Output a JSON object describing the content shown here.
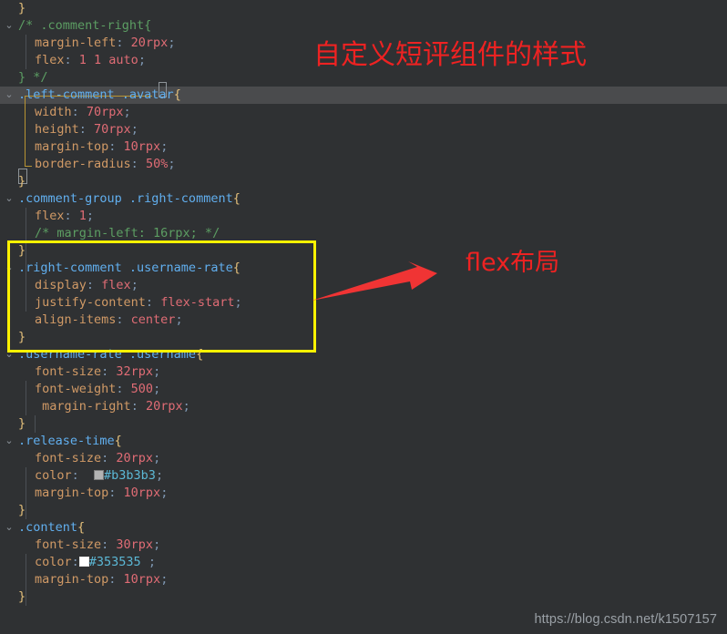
{
  "editor": {
    "background": "#2f3133",
    "active_line_background": "#4a4b4d",
    "active_line_index": 5,
    "line_height": 19,
    "first_line_top": 0,
    "colors": {
      "selector": "#61afef",
      "brace": "#e5c07b",
      "property": "#d19a66",
      "value": "#e06c75",
      "punctuation": "#7f98b3",
      "comment": "#5c9e63",
      "hex_literal": "#5cb8d6",
      "fold_chevron": "#8b9299",
      "indent_guide": "#4b5055",
      "scope_guide": "#b89433"
    },
    "lines": [
      {
        "indent": 0,
        "fold": false,
        "text": "}"
      },
      {
        "indent": 0,
        "fold": true,
        "text": "/* .comment-right{"
      },
      {
        "indent": 1,
        "fold": false,
        "text": "margin-left: 20rpx;"
      },
      {
        "indent": 1,
        "fold": false,
        "text": "flex: 1 1 auto;"
      },
      {
        "indent": 0,
        "fold": false,
        "text": "} */"
      },
      {
        "indent": 0,
        "fold": true,
        "text": ".left-comment .avatar{"
      },
      {
        "indent": 1,
        "fold": false,
        "text": "width: 70rpx;"
      },
      {
        "indent": 1,
        "fold": false,
        "text": "height: 70rpx;"
      },
      {
        "indent": 1,
        "fold": false,
        "text": "margin-top: 10rpx;"
      },
      {
        "indent": 1,
        "fold": false,
        "text": "border-radius: 50%;"
      },
      {
        "indent": 0,
        "fold": false,
        "text": "}"
      },
      {
        "indent": 0,
        "fold": true,
        "text": ".comment-group .right-comment{"
      },
      {
        "indent": 1,
        "fold": false,
        "text": "flex: 1;"
      },
      {
        "indent": 1,
        "fold": false,
        "text": "/* margin-left: 16rpx; */"
      },
      {
        "indent": 0,
        "fold": false,
        "text": "}"
      },
      {
        "indent": 0,
        "fold": true,
        "text": ".right-comment .username-rate{"
      },
      {
        "indent": 1,
        "fold": false,
        "text": "display: flex;"
      },
      {
        "indent": 1,
        "fold": false,
        "text": "justify-content: flex-start;"
      },
      {
        "indent": 1,
        "fold": false,
        "text": "align-items: center;"
      },
      {
        "indent": 0,
        "fold": false,
        "text": "}"
      },
      {
        "indent": 0,
        "fold": true,
        "text": ".username-rate .username{"
      },
      {
        "indent": 1,
        "fold": false,
        "text": "font-size: 32rpx;"
      },
      {
        "indent": 1,
        "fold": false,
        "text": "font-weight: 500;"
      },
      {
        "indent": 1,
        "fold": false,
        "text": " margin-right: 20rpx;"
      },
      {
        "indent": 0,
        "fold": false,
        "text": "}"
      },
      {
        "indent": 0,
        "fold": true,
        "text": ".release-time{"
      },
      {
        "indent": 1,
        "fold": false,
        "text": "font-size: 20rpx;"
      },
      {
        "indent": 1,
        "fold": false,
        "text": "color:  #b3b3b3;"
      },
      {
        "indent": 1,
        "fold": false,
        "text": "margin-top: 10rpx;"
      },
      {
        "indent": 0,
        "fold": false,
        "text": "}"
      },
      {
        "indent": 0,
        "fold": true,
        "text": ".content{"
      },
      {
        "indent": 1,
        "fold": false,
        "text": "font-size: 30rpx;"
      },
      {
        "indent": 1,
        "fold": false,
        "text": "color:#353535 ;"
      },
      {
        "indent": 1,
        "fold": false,
        "text": "margin-top: 10rpx;"
      },
      {
        "indent": 0,
        "fold": false,
        "text": "}"
      }
    ],
    "fold_chevron_glyph": "⌄",
    "swatches": [
      {
        "line": 27,
        "hex": "#b3b3b3"
      },
      {
        "line": 32,
        "hex": "#353535"
      }
    ]
  },
  "annotations": {
    "title_note": "自定义短评组件的样式",
    "flex_note": "flex布局",
    "annotation_color": "#ee2222",
    "highlight_box_color": "#fff200",
    "arrow_color": "#f03434"
  },
  "watermark": {
    "text": "https://blog.csdn.net/k1507157",
    "color": "#9aa0a6"
  }
}
